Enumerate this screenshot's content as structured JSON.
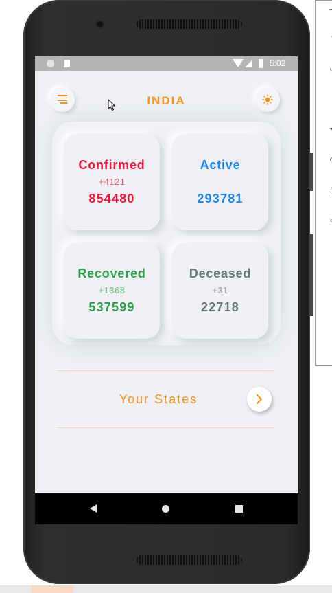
{
  "app": {
    "country_title": "INDIA",
    "accent_color": "#f7931e"
  },
  "statusbar": {
    "time": "5:02",
    "icons": [
      "notification-dot-icon",
      "sd-card-icon",
      "wifi-icon",
      "cell-signal-icon",
      "battery-icon"
    ]
  },
  "header": {
    "menu_icon": "menu-icon",
    "theme_icon": "sun-icon"
  },
  "stats": {
    "confirmed": {
      "label": "Confirmed",
      "delta": "+4121",
      "value": "854480",
      "color": "#e8193c"
    },
    "active": {
      "label": "Active",
      "delta": "",
      "value": "293781",
      "color": "#1e88e5"
    },
    "recovered": {
      "label": "Recovered",
      "delta": "+1368",
      "value": "537599",
      "color": "#2e9e4d"
    },
    "deceased": {
      "label": "Deceased",
      "delta": "+31",
      "value": "22718",
      "color": "#6d747a"
    }
  },
  "states_section": {
    "label": "Your States",
    "arrow_icon": "chevron-right-icon"
  },
  "navbar": {
    "icons": [
      "back-icon",
      "home-icon",
      "recents-icon"
    ]
  }
}
